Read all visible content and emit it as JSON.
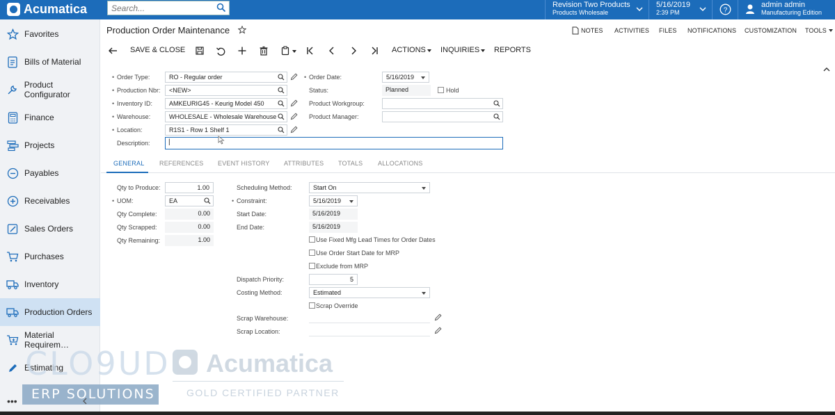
{
  "topbar": {
    "logo_text": "Acumatica",
    "search_placeholder": "Search...",
    "company_line1": "Revision Two Products",
    "company_line2": "Products Wholesale",
    "date_line1": "5/16/2019",
    "date_line2": "2:39 PM",
    "user_line1": "admin admin",
    "user_line2": "Manufacturing Edition",
    "brand_color": "#1c6cba"
  },
  "sidebar": {
    "items": [
      {
        "label": "Favorites",
        "icon": "star-icon"
      },
      {
        "label": "Bills of Material",
        "icon": "document-icon"
      },
      {
        "label": "Product Configurator",
        "icon": "wrench-icon"
      },
      {
        "label": "Finance",
        "icon": "calculator-icon"
      },
      {
        "label": "Projects",
        "icon": "projects-icon"
      },
      {
        "label": "Payables",
        "icon": "minus-circle-icon"
      },
      {
        "label": "Receivables",
        "icon": "plus-circle-icon"
      },
      {
        "label": "Sales Orders",
        "icon": "edit-icon"
      },
      {
        "label": "Purchases",
        "icon": "cart-icon"
      },
      {
        "label": "Inventory",
        "icon": "truck-icon"
      },
      {
        "label": "Production Orders",
        "icon": "truck-icon"
      },
      {
        "label": "Material Requirem…",
        "icon": "cart-plus-icon"
      },
      {
        "label": "Estimating",
        "icon": "pencil-icon"
      }
    ],
    "more": "•••"
  },
  "page": {
    "title": "Production Order Maintenance",
    "links": [
      "NOTES",
      "ACTIVITIES",
      "FILES",
      "NOTIFICATIONS",
      "CUSTOMIZATION",
      "TOOLS"
    ],
    "toolbar": {
      "save_close": "SAVE & CLOSE",
      "actions": "ACTIONS",
      "inquiries": "INQUIRIES",
      "reports": "REPORTS"
    }
  },
  "header_form": {
    "order_type_label": "Order Type:",
    "order_type_value": "RO - Regular order",
    "production_nbr_label": "Production Nbr:",
    "production_nbr_value": "<NEW>",
    "inventory_id_label": "Inventory ID:",
    "inventory_id_value": "AMKEURIG45 - Keurig Model 450",
    "warehouse_label": "Warehouse:",
    "warehouse_value": "WHOLESALE - Wholesale Warehouse",
    "location_label": "Location:",
    "location_value": "R1S1 - Row 1 Shelf 1",
    "description_label": "Description:",
    "description_value": "|",
    "order_date_label": "Order Date:",
    "order_date_value": "5/16/2019",
    "status_label": "Status:",
    "status_value": "Planned",
    "hold_label": "Hold",
    "product_workgroup_label": "Product Workgroup:",
    "product_manager_label": "Product Manager:"
  },
  "tabs": [
    "GENERAL",
    "REFERENCES",
    "EVENT HISTORY",
    "ATTRIBUTES",
    "TOTALS",
    "ALLOCATIONS"
  ],
  "general": {
    "qty_to_produce_label": "Qty to Produce:",
    "qty_to_produce_value": "1.00",
    "uom_label": "UOM:",
    "uom_value": "EA",
    "qty_complete_label": "Qty Complete:",
    "qty_complete_value": "0.00",
    "qty_scrapped_label": "Qty Scrapped:",
    "qty_scrapped_value": "0.00",
    "qty_remaining_label": "Qty Remaining:",
    "qty_remaining_value": "1.00",
    "scheduling_method_label": "Scheduling Method:",
    "scheduling_method_value": "Start On",
    "constraint_label": "Constraint:",
    "constraint_value": "5/16/2019",
    "start_date_label": "Start Date:",
    "start_date_value": "5/16/2019",
    "end_date_label": "End Date:",
    "end_date_value": "5/16/2019",
    "fixed_mfg_label": "Use Fixed Mfg Lead Times for Order Dates",
    "order_start_mrp_label": "Use Order Start Date for MRP",
    "exclude_mrp_label": "Exclude from MRP",
    "dispatch_priority_label": "Dispatch Priority:",
    "dispatch_priority_value": "5",
    "costing_method_label": "Costing Method:",
    "costing_method_value": "Estimated",
    "scrap_override_label": "Scrap Override",
    "scrap_warehouse_label": "Scrap Warehouse:",
    "scrap_location_label": "Scrap Location:"
  },
  "watermark": {
    "cloud": "CLO9UD",
    "erp": "ERP SOLUTIONS",
    "acumatica": "Acumatica",
    "partner": "GOLD CERTIFIED PARTNER"
  }
}
